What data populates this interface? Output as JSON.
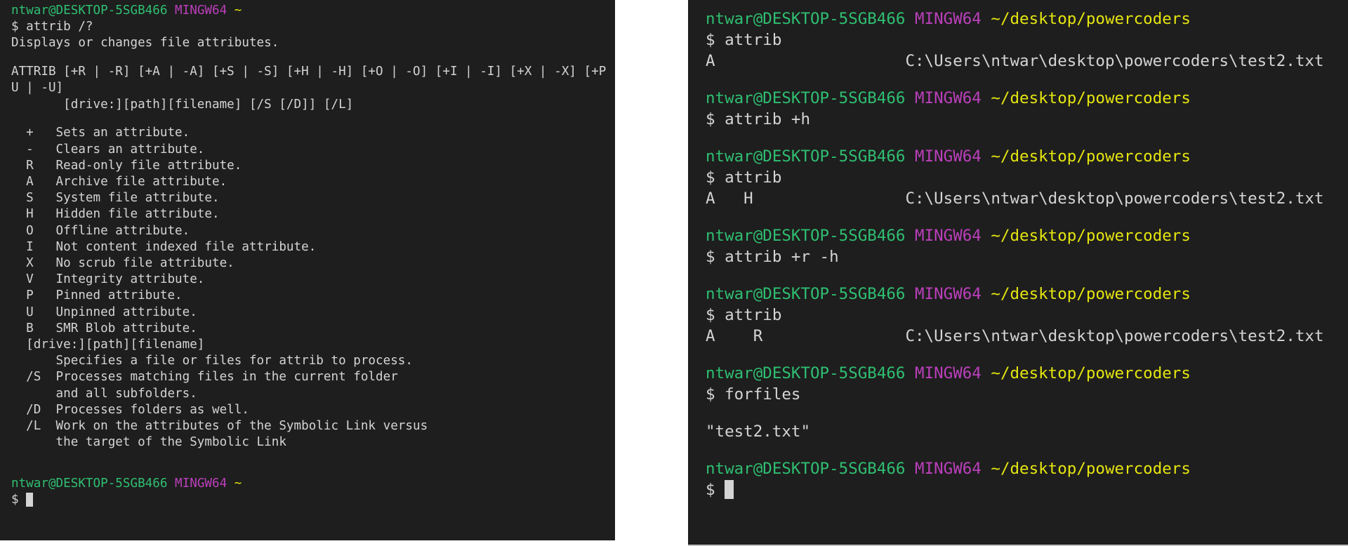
{
  "left_terminal": {
    "lines": [
      {
        "segments": [
          {
            "text": "ntwar@DESKTOP-5SGB466",
            "color": "green"
          },
          {
            "text": " "
          },
          {
            "text": "MINGW64",
            "color": "magenta"
          },
          {
            "text": " "
          },
          {
            "text": "~",
            "color": "yellow"
          }
        ]
      },
      {
        "segments": [
          {
            "text": "$ attrib /?"
          }
        ]
      },
      {
        "segments": [
          {
            "text": "Displays or changes file attributes."
          }
        ]
      },
      {
        "segments": [
          {
            "text": ""
          }
        ]
      },
      {
        "segments": [
          {
            "text": "ATTRIB [+R | -R] [+A | -A] [+S | -S] [+H | -H] [+O | -O] [+I | -I] [+X | -X] [+P"
          }
        ]
      },
      {
        "segments": [
          {
            "text": "U | -U]"
          }
        ]
      },
      {
        "segments": [
          {
            "text": "       [drive:][path][filename] [/S [/D]] [/L]"
          }
        ]
      },
      {
        "segments": [
          {
            "text": ""
          }
        ]
      },
      {
        "segments": [
          {
            "text": "  +   Sets an attribute."
          }
        ]
      },
      {
        "segments": [
          {
            "text": "  -   Clears an attribute."
          }
        ]
      },
      {
        "segments": [
          {
            "text": "  R   Read-only file attribute."
          }
        ]
      },
      {
        "segments": [
          {
            "text": "  A   Archive file attribute."
          }
        ]
      },
      {
        "segments": [
          {
            "text": "  S   System file attribute."
          }
        ]
      },
      {
        "segments": [
          {
            "text": "  H   Hidden file attribute."
          }
        ]
      },
      {
        "segments": [
          {
            "text": "  O   Offline attribute."
          }
        ]
      },
      {
        "segments": [
          {
            "text": "  I   Not content indexed file attribute."
          }
        ]
      },
      {
        "segments": [
          {
            "text": "  X   No scrub file attribute."
          }
        ]
      },
      {
        "segments": [
          {
            "text": "  V   Integrity attribute."
          }
        ]
      },
      {
        "segments": [
          {
            "text": "  P   Pinned attribute."
          }
        ]
      },
      {
        "segments": [
          {
            "text": "  U   Unpinned attribute."
          }
        ]
      },
      {
        "segments": [
          {
            "text": "  B   SMR Blob attribute."
          }
        ]
      },
      {
        "segments": [
          {
            "text": "  [drive:][path][filename]"
          }
        ]
      },
      {
        "segments": [
          {
            "text": "      Specifies a file or files for attrib to process."
          }
        ]
      },
      {
        "segments": [
          {
            "text": "  /S  Processes matching files in the current folder"
          }
        ]
      },
      {
        "segments": [
          {
            "text": "      and all subfolders."
          }
        ]
      },
      {
        "segments": [
          {
            "text": "  /D  Processes folders as well."
          }
        ]
      },
      {
        "segments": [
          {
            "text": "  /L  Work on the attributes of the Symbolic Link versus"
          }
        ]
      },
      {
        "segments": [
          {
            "text": "      the target of the Symbolic Link"
          }
        ]
      },
      {
        "segments": [
          {
            "text": ""
          }
        ]
      },
      {
        "segments": [
          {
            "text": ""
          }
        ]
      },
      {
        "segments": [
          {
            "text": "ntwar@DESKTOP-5SGB466",
            "color": "green"
          },
          {
            "text": " "
          },
          {
            "text": "MINGW64",
            "color": "magenta"
          },
          {
            "text": " "
          },
          {
            "text": "~",
            "color": "yellow"
          }
        ]
      },
      {
        "segments": [
          {
            "text": "$ "
          }
        ],
        "cursor": true
      }
    ]
  },
  "right_terminal": {
    "lines": [
      {
        "segments": [
          {
            "text": "ntwar@DESKTOP-5SGB466",
            "color": "green"
          },
          {
            "text": " "
          },
          {
            "text": "MINGW64",
            "color": "magenta"
          },
          {
            "text": " "
          },
          {
            "text": "~/desktop/powercoders",
            "color": "yellow"
          }
        ]
      },
      {
        "segments": [
          {
            "text": "$ attrib"
          }
        ]
      },
      {
        "segments": [
          {
            "text": "A                    C:\\Users\\ntwar\\desktop\\powercoders\\test2.txt"
          }
        ]
      },
      {
        "segments": [
          {
            "text": ""
          }
        ]
      },
      {
        "segments": [
          {
            "text": "ntwar@DESKTOP-5SGB466",
            "color": "green"
          },
          {
            "text": " "
          },
          {
            "text": "MINGW64",
            "color": "magenta"
          },
          {
            "text": " "
          },
          {
            "text": "~/desktop/powercoders",
            "color": "yellow"
          }
        ]
      },
      {
        "segments": [
          {
            "text": "$ attrib +h"
          }
        ]
      },
      {
        "segments": [
          {
            "text": ""
          }
        ]
      },
      {
        "segments": [
          {
            "text": "ntwar@DESKTOP-5SGB466",
            "color": "green"
          },
          {
            "text": " "
          },
          {
            "text": "MINGW64",
            "color": "magenta"
          },
          {
            "text": " "
          },
          {
            "text": "~/desktop/powercoders",
            "color": "yellow"
          }
        ]
      },
      {
        "segments": [
          {
            "text": "$ attrib"
          }
        ]
      },
      {
        "segments": [
          {
            "text": "A   H                C:\\Users\\ntwar\\desktop\\powercoders\\test2.txt"
          }
        ]
      },
      {
        "segments": [
          {
            "text": ""
          }
        ]
      },
      {
        "segments": [
          {
            "text": "ntwar@DESKTOP-5SGB466",
            "color": "green"
          },
          {
            "text": " "
          },
          {
            "text": "MINGW64",
            "color": "magenta"
          },
          {
            "text": " "
          },
          {
            "text": "~/desktop/powercoders",
            "color": "yellow"
          }
        ]
      },
      {
        "segments": [
          {
            "text": "$ attrib +r -h"
          }
        ]
      },
      {
        "segments": [
          {
            "text": ""
          }
        ]
      },
      {
        "segments": [
          {
            "text": "ntwar@DESKTOP-5SGB466",
            "color": "green"
          },
          {
            "text": " "
          },
          {
            "text": "MINGW64",
            "color": "magenta"
          },
          {
            "text": " "
          },
          {
            "text": "~/desktop/powercoders",
            "color": "yellow"
          }
        ]
      },
      {
        "segments": [
          {
            "text": "$ attrib"
          }
        ]
      },
      {
        "segments": [
          {
            "text": "A    R               C:\\Users\\ntwar\\desktop\\powercoders\\test2.txt"
          }
        ]
      },
      {
        "segments": [
          {
            "text": ""
          }
        ]
      },
      {
        "segments": [
          {
            "text": "ntwar@DESKTOP-5SGB466",
            "color": "green"
          },
          {
            "text": " "
          },
          {
            "text": "MINGW64",
            "color": "magenta"
          },
          {
            "text": " "
          },
          {
            "text": "~/desktop/powercoders",
            "color": "yellow"
          }
        ]
      },
      {
        "segments": [
          {
            "text": "$ forfiles"
          }
        ]
      },
      {
        "segments": [
          {
            "text": ""
          }
        ]
      },
      {
        "segments": [
          {
            "text": "\"test2.txt\""
          }
        ]
      },
      {
        "segments": [
          {
            "text": ""
          }
        ]
      },
      {
        "segments": [
          {
            "text": "ntwar@DESKTOP-5SGB466",
            "color": "green"
          },
          {
            "text": " "
          },
          {
            "text": "MINGW64",
            "color": "magenta"
          },
          {
            "text": " "
          },
          {
            "text": "~/desktop/powercoders",
            "color": "yellow"
          }
        ]
      },
      {
        "segments": [
          {
            "text": "$ "
          }
        ],
        "cursor": true
      }
    ]
  }
}
